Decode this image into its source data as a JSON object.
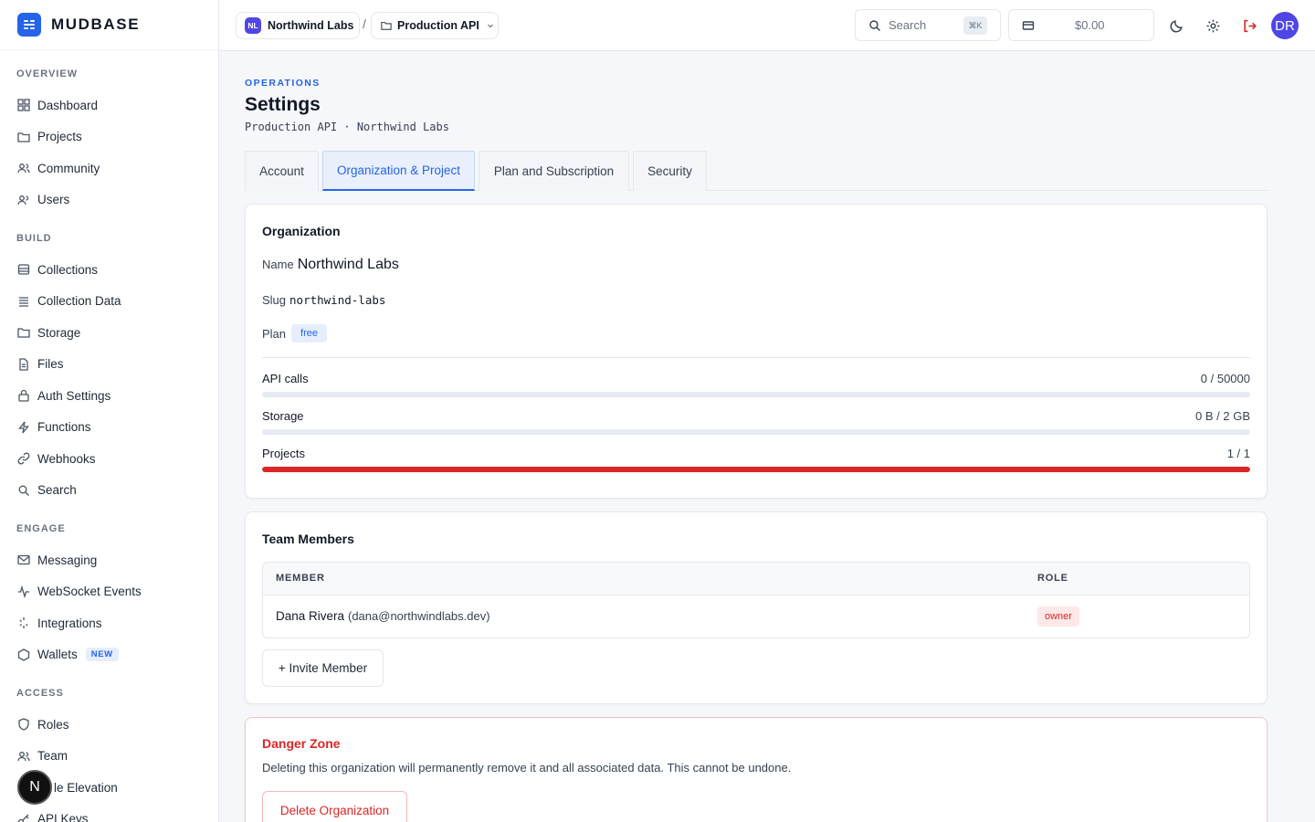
{
  "brand": {
    "name": "MUDBASE"
  },
  "sidebar": {
    "sections": [
      {
        "title": "OVERVIEW",
        "items": [
          {
            "label": "Dashboard",
            "icon": "grid-icon"
          },
          {
            "label": "Projects",
            "icon": "folder-icon"
          },
          {
            "label": "Community",
            "icon": "users-icon"
          },
          {
            "label": "Users",
            "icon": "user-icon"
          }
        ]
      },
      {
        "title": "BUILD",
        "items": [
          {
            "label": "Collections",
            "icon": "database-icon"
          },
          {
            "label": "Collection Data",
            "icon": "list-icon"
          },
          {
            "label": "Storage",
            "icon": "folder-icon"
          },
          {
            "label": "Files",
            "icon": "file-icon"
          },
          {
            "label": "Auth Settings",
            "icon": "lock-icon"
          },
          {
            "label": "Functions",
            "icon": "bolt-icon"
          },
          {
            "label": "Webhooks",
            "icon": "link-icon"
          },
          {
            "label": "Search",
            "icon": "search-icon"
          }
        ]
      },
      {
        "title": "ENGAGE",
        "items": [
          {
            "label": "Messaging",
            "icon": "mail-icon"
          },
          {
            "label": "WebSocket Events",
            "icon": "activity-icon"
          },
          {
            "label": "Integrations",
            "icon": "plug-icon"
          },
          {
            "label": "Wallets",
            "icon": "hexagon-icon",
            "badge": "NEW"
          }
        ]
      },
      {
        "title": "ACCESS",
        "items": [
          {
            "label": "Roles",
            "icon": "shield-icon"
          },
          {
            "label": "Team",
            "icon": "users-icon"
          },
          {
            "label": "le Elevation",
            "icon": "arrow-up-icon"
          },
          {
            "label": "API Keys",
            "icon": "key-icon"
          }
        ]
      }
    ]
  },
  "header": {
    "org_initials": "NL",
    "org_name": "Northwind Labs",
    "separator": "/",
    "project_name": "Production API",
    "search_placeholder": "Search",
    "search_shortcut": "⌘K",
    "balance": "$0.00",
    "user_initials": "DR"
  },
  "page": {
    "eyebrow": "OPERATIONS",
    "title": "Settings",
    "subtitle": "Production API · Northwind Labs",
    "tabs": [
      {
        "label": "Account",
        "active": false
      },
      {
        "label": "Organization & Project",
        "active": true
      },
      {
        "label": "Plan and Subscription",
        "active": false
      },
      {
        "label": "Security",
        "active": false
      }
    ]
  },
  "organization": {
    "heading": "Organization",
    "name_label": "Name",
    "name_value": "Northwind Labs",
    "slug_label": "Slug",
    "slug_value": "northwind-labs",
    "plan_label": "Plan",
    "plan_value": "free",
    "usage": [
      {
        "label": "API calls",
        "value": "0 / 50000",
        "fraction": 0,
        "color": "#2563eb"
      },
      {
        "label": "Storage",
        "value": "0 B / 2 GB",
        "fraction": 0,
        "color": "#2563eb"
      },
      {
        "label": "Projects",
        "value": "1 / 1",
        "fraction": 1,
        "color": "#dc2626"
      }
    ]
  },
  "team": {
    "heading": "Team Members",
    "columns": [
      "MEMBER",
      "ROLE"
    ],
    "rows": [
      {
        "name": "Dana Rivera",
        "email": "(dana@northwindlabs.dev)",
        "role": "owner"
      }
    ],
    "invite_label": "+ Invite Member"
  },
  "danger": {
    "heading": "Danger Zone",
    "text": "Deleting this organization will permanently remove it and all associated data. This cannot be undone.",
    "button_label": "Delete Organization"
  },
  "fab": {
    "label": "N"
  }
}
